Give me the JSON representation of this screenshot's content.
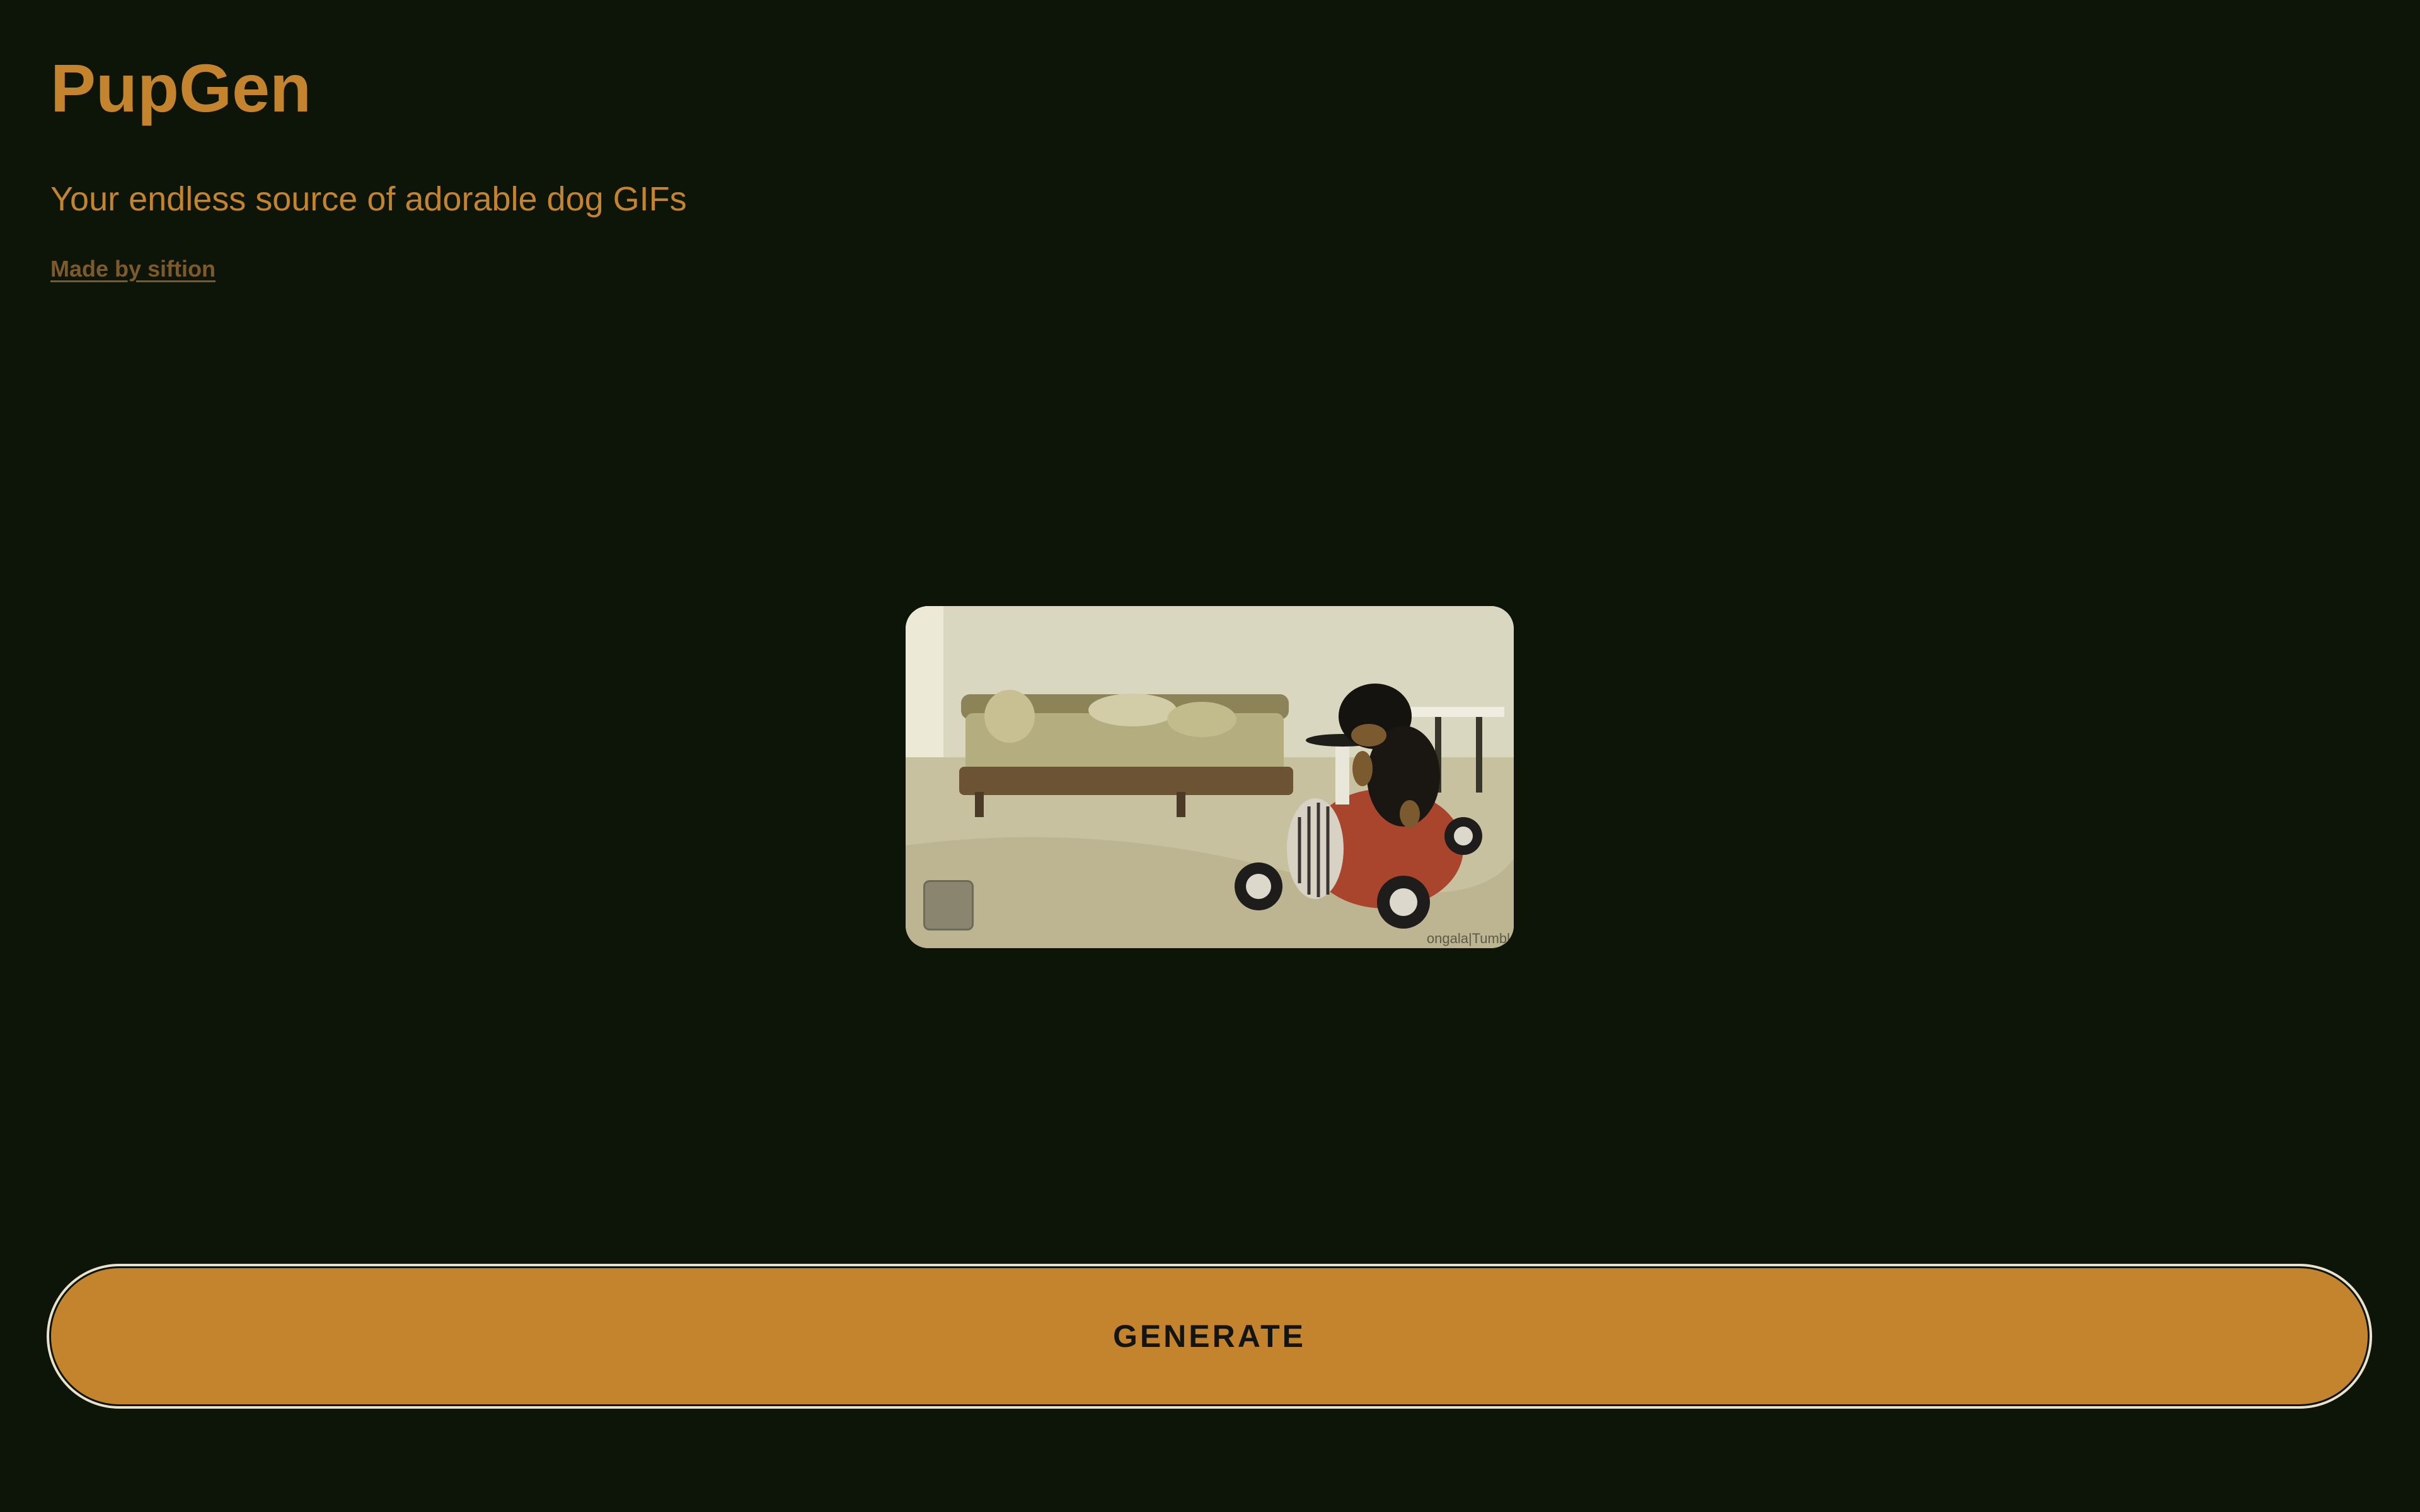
{
  "app": {
    "title": "PupGen",
    "subtitle": "Your endless source of adorable dog GIFs",
    "credit_link": "Made by siftion"
  },
  "gif": {
    "watermark": "ongala|Tumbl",
    "logo_icon": "dog-logo-icon"
  },
  "actions": {
    "generate_label": "GENERATE"
  },
  "colors": {
    "background": "#0d1508",
    "accent": "#c4832d",
    "link": "#7d5a2c",
    "button_text": "#141412",
    "button_outline": "#e9e2cf"
  }
}
